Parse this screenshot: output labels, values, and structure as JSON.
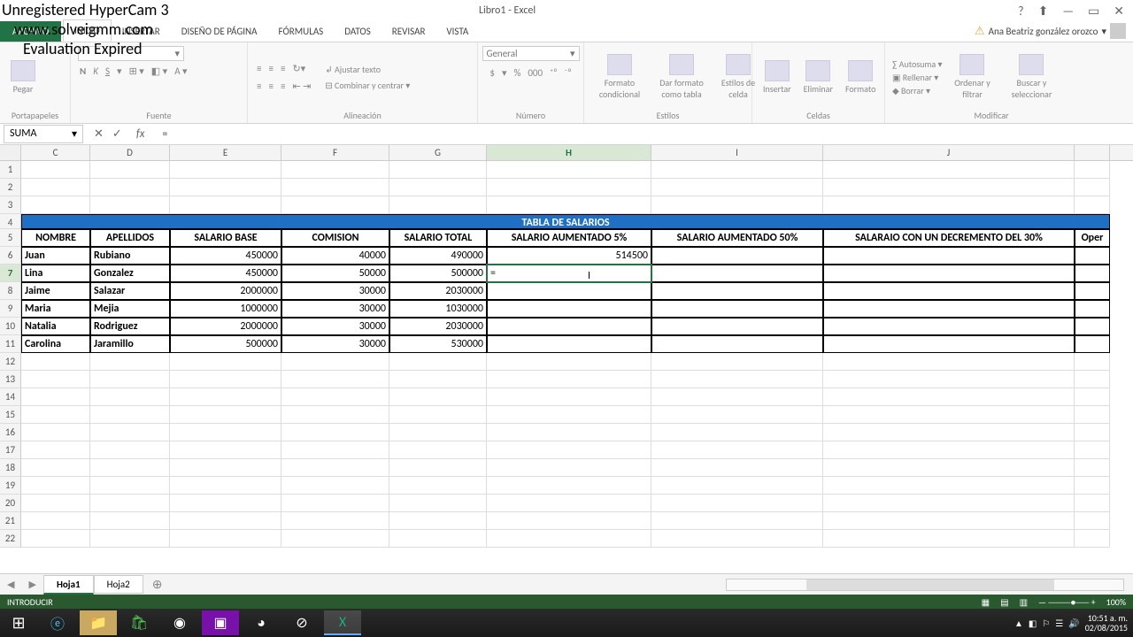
{
  "watermark": {
    "l1": "Unregistered HyperCam 3",
    "l2": "www.solveigmm.com",
    "l3": "Evaluation Expired"
  },
  "titlebar": {
    "title": "Libro1 - Excel",
    "help": "?",
    "min": "—",
    "restore": "▭",
    "close": "✕"
  },
  "user": {
    "name": "Ana Beatriz gonzález orozco",
    "dropdown": "▾"
  },
  "tabs": {
    "file": "ARCHIVO",
    "inicio": "INICIO",
    "insertar": "INSERTAR",
    "diseno": "DISEÑO DE PÁGINA",
    "formulas": "FÓRMULAS",
    "datos": "DATOS",
    "revisar": "REVISAR",
    "vista": "VISTA"
  },
  "ribbon": {
    "portapapeles": {
      "label": "Portapapeles",
      "pegar": "Pegar"
    },
    "fuente": {
      "label": "Fuente",
      "bold": "N",
      "italic": "K",
      "underline": "S"
    },
    "alineacion": {
      "label": "Alineación",
      "ajustar": "Ajustar texto",
      "combinar": "Combinar y centrar"
    },
    "numero": {
      "label": "Número",
      "general": "General",
      "currency": "$",
      "percent": "%",
      "thousands": "000"
    },
    "estilos": {
      "label": "Estilos",
      "cond": "Formato condicional",
      "tabla": "Dar formato como tabla",
      "celda": "Estilos de celda"
    },
    "celdas": {
      "label": "Celdas",
      "insertar": "Insertar",
      "eliminar": "Eliminar",
      "formato": "Formato"
    },
    "modificar": {
      "label": "Modificar",
      "autosuma": "Autosuma",
      "rellenar": "Rellenar",
      "borrar": "Borrar",
      "ordenar": "Ordenar y filtrar",
      "buscar": "Buscar y seleccionar"
    }
  },
  "formula": {
    "namebox": "SUMA",
    "fx": "fx",
    "value": "="
  },
  "columns": [
    "C",
    "D",
    "E",
    "F",
    "G",
    "H",
    "I",
    "J"
  ],
  "lastcol": "Oper",
  "tableTitle": "TABLA DE SALARIOS",
  "headers": {
    "nombre": "NOMBRE",
    "apellidos": "APELLIDOS",
    "base": "SALARIO BASE",
    "comision": "COMISION",
    "total": "SALARIO TOTAL",
    "aum5": "SALARIO AUMENTADO 5%",
    "aum50": "SALARIO AUMENTADO 50%",
    "dec30": "SALARAIO CON UN DECREMENTO DEL 30%"
  },
  "rows": [
    {
      "n": "Juan",
      "a": "Rubiano",
      "base": "450000",
      "com": "40000",
      "tot": "490000",
      "a5": "514500"
    },
    {
      "n": "Lina",
      "a": "Gonzalez",
      "base": "450000",
      "com": "50000",
      "tot": "500000",
      "a5": "="
    },
    {
      "n": "Jaime",
      "a": "Salazar",
      "base": "2000000",
      "com": "30000",
      "tot": "2030000",
      "a5": ""
    },
    {
      "n": "Maria",
      "a": "Mejia",
      "base": "1000000",
      "com": "30000",
      "tot": "1030000",
      "a5": ""
    },
    {
      "n": "Natalia",
      "a": "Rodriguez",
      "base": "2000000",
      "com": "30000",
      "tot": "2030000",
      "a5": ""
    },
    {
      "n": "Carolina",
      "a": "Jaramillo",
      "base": "500000",
      "com": "30000",
      "tot": "530000",
      "a5": ""
    }
  ],
  "sheets": {
    "h1": "Hoja1",
    "h2": "Hoja2",
    "add": "⊕"
  },
  "statusbar": {
    "mode": "INTRODUCIR",
    "zoom": "100%"
  },
  "taskbar": {
    "time": "10:51 a. m.",
    "date": "02/08/2015"
  }
}
